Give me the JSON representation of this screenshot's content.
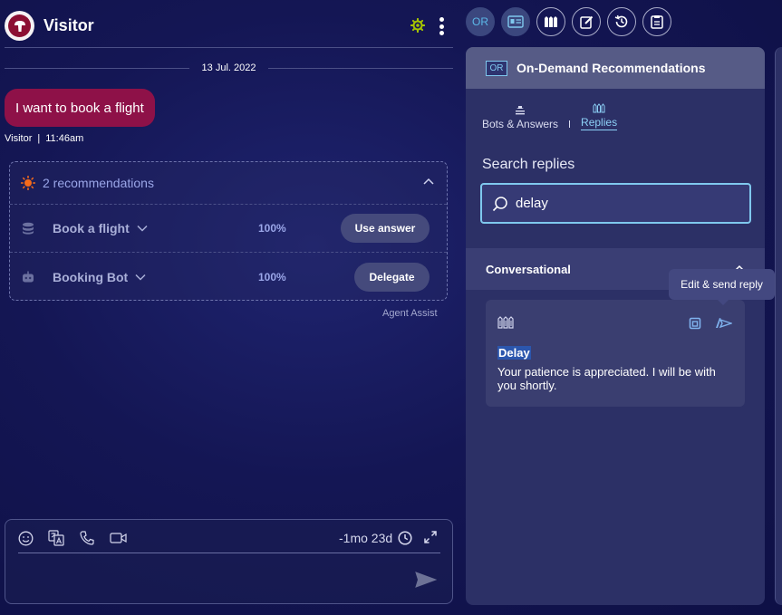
{
  "header": {
    "title": "Visitor",
    "status_color": "#a4c400"
  },
  "conversation": {
    "date": "13 Jul. 2022",
    "message": {
      "text": "I want to book a flight",
      "sender": "Visitor",
      "separator": "|",
      "time": "11:46am",
      "color": "#8e1148"
    }
  },
  "recommendations": {
    "title": "2 recommendations",
    "items": [
      {
        "name": "Book a flight",
        "icon": "database-icon",
        "confidence": "100%",
        "action": "Use answer"
      },
      {
        "name": "Booking Bot",
        "icon": "bot-icon",
        "confidence": "100%",
        "action": "Delegate"
      }
    ],
    "footer": "Agent Assist"
  },
  "composer": {
    "tools": [
      "emoji-icon",
      "translate-icon",
      "phone-icon",
      "video-icon"
    ],
    "timer": "-1mo 23d",
    "placeholder": ""
  },
  "toolbar": {
    "items": [
      {
        "label": "OR",
        "name": "on-demand-recommendations"
      },
      {
        "icon": "agent-card-icon"
      },
      {
        "icon": "replies-icon"
      },
      {
        "icon": "edit-note-icon"
      },
      {
        "icon": "history-icon"
      },
      {
        "icon": "clipboard-icon"
      }
    ]
  },
  "panel": {
    "badge": "OR",
    "title": "On-Demand Recommendations",
    "tabs": [
      {
        "label": "Bots & Answers",
        "active": false
      },
      {
        "label": "Replies",
        "active": true
      }
    ],
    "tab_separator": "|",
    "search_label": "Search replies",
    "search_value": "delay",
    "section": "Conversational",
    "card": {
      "title": "Delay",
      "body": "Your patience is appreciated. I will be with you shortly."
    },
    "tooltip": "Edit & send reply",
    "accent": "#7fc8ee"
  }
}
